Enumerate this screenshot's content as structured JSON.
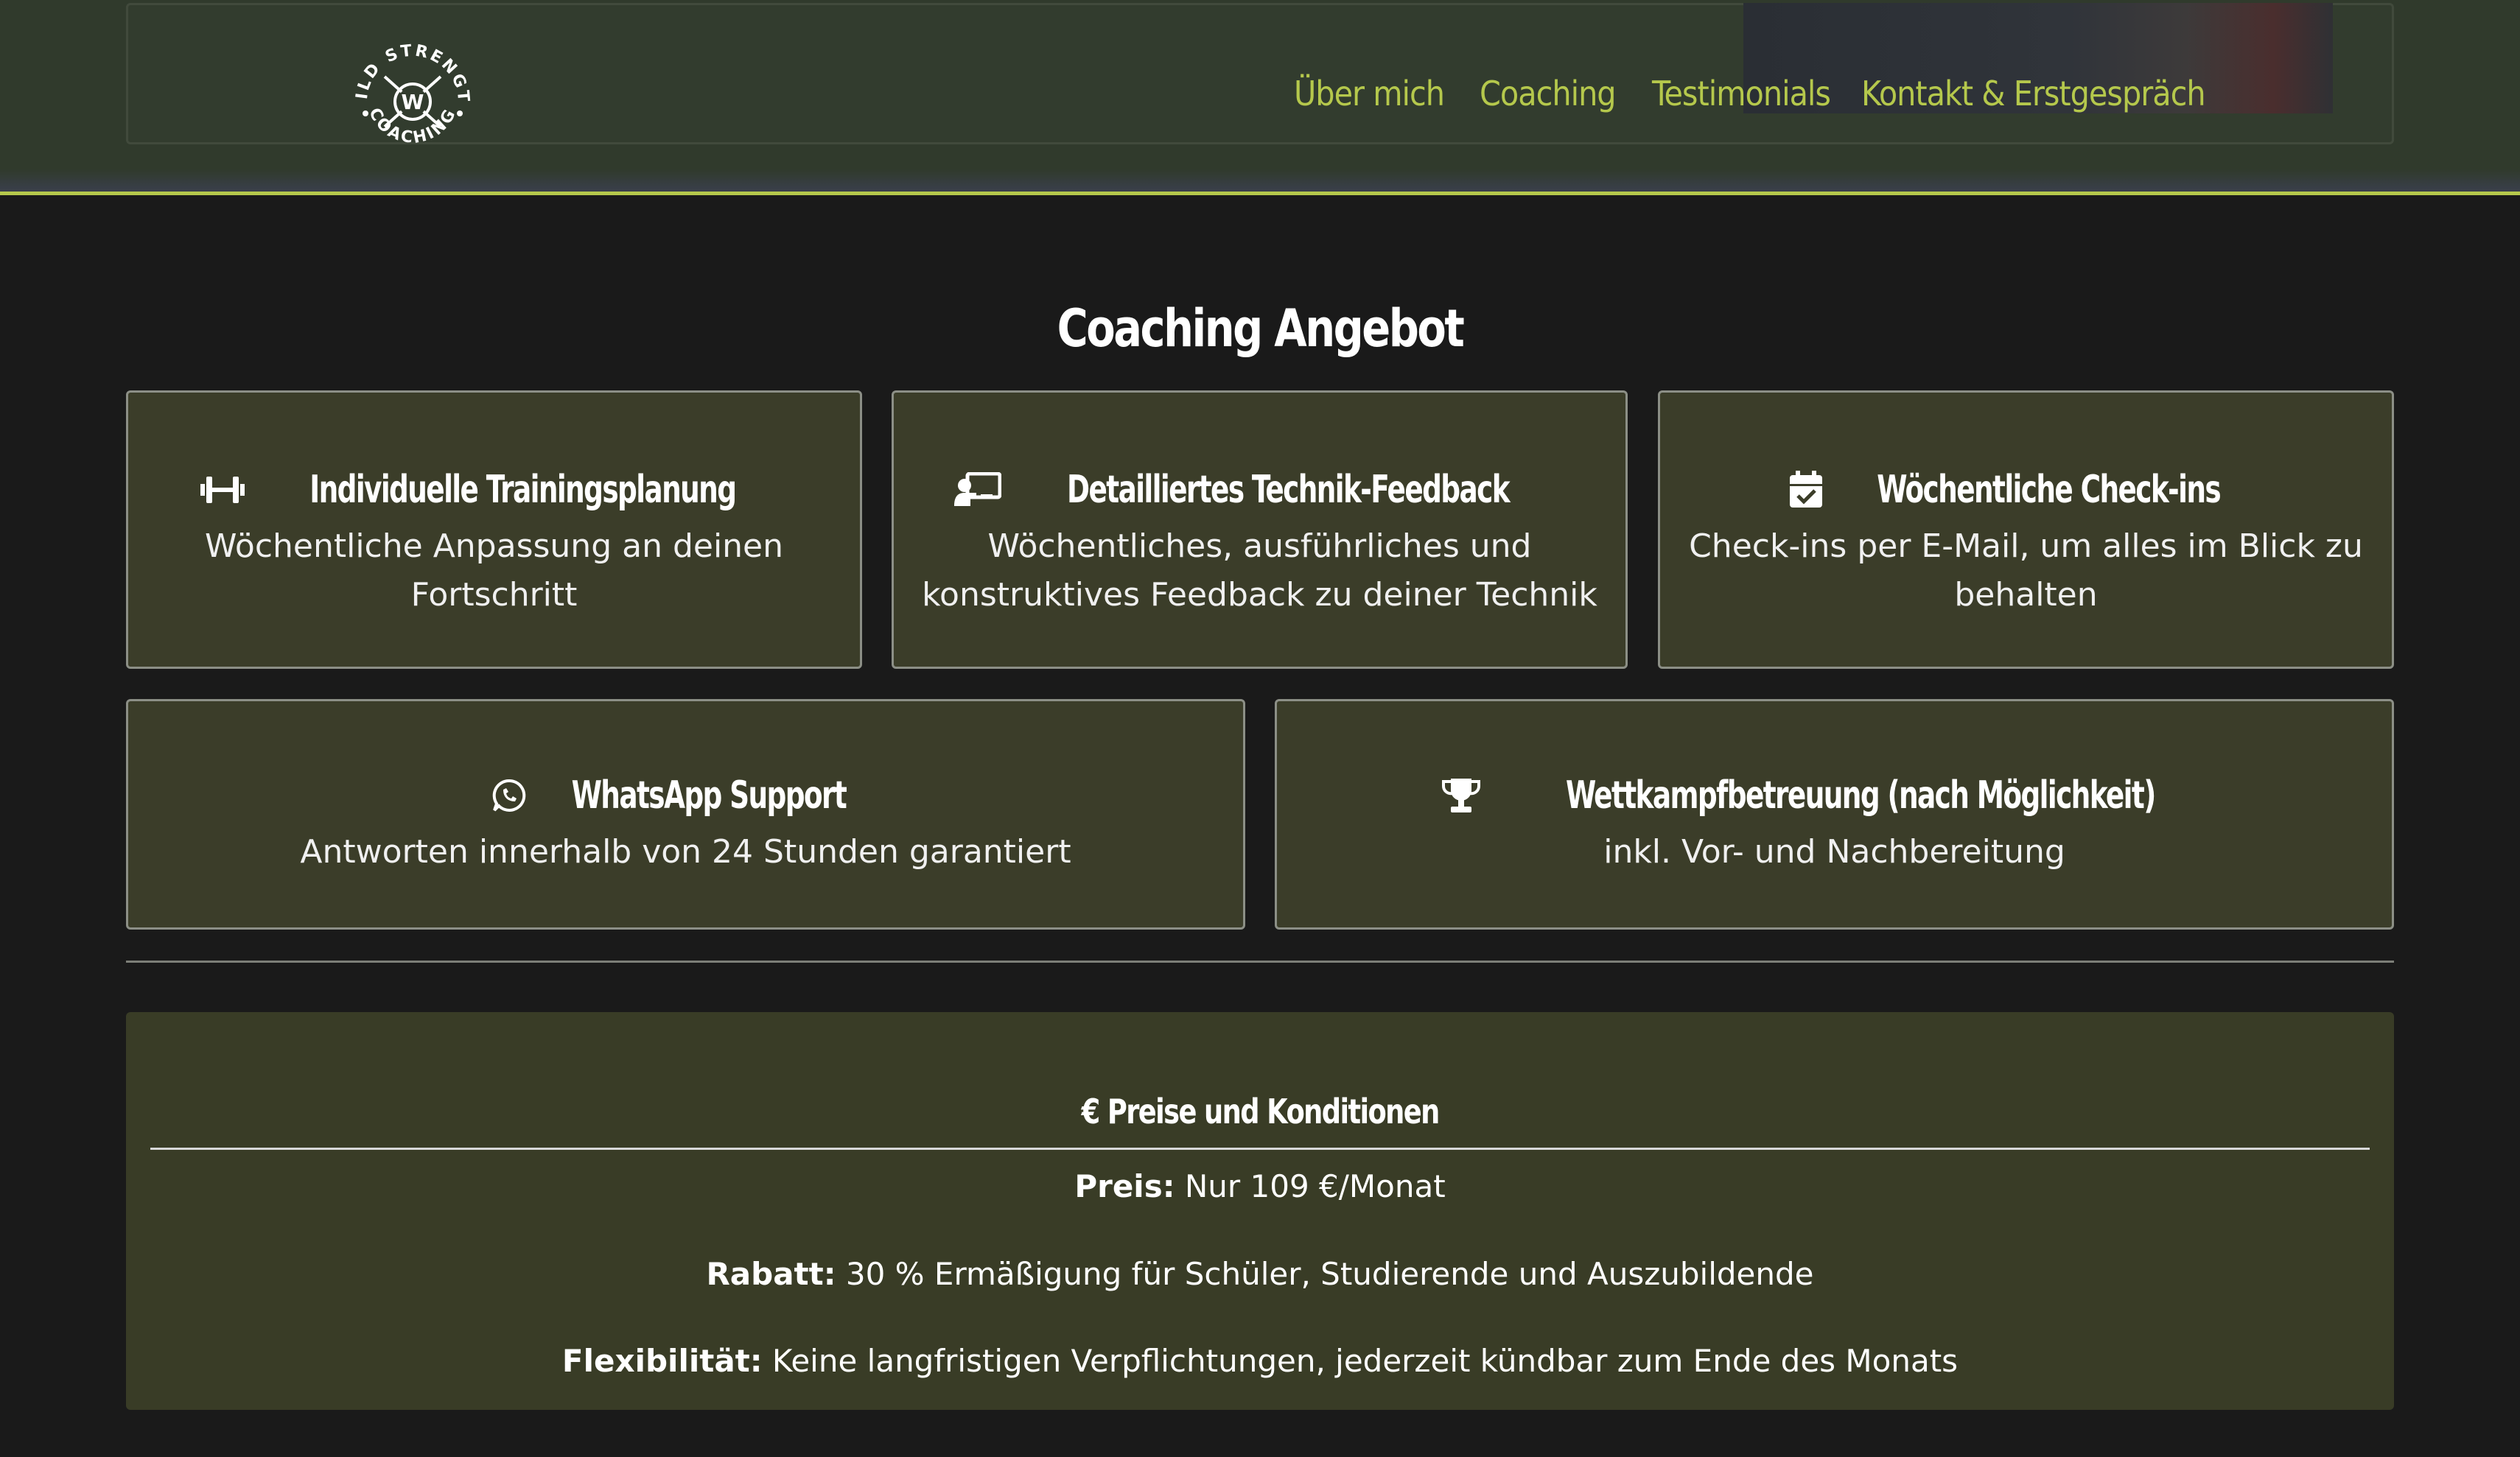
{
  "header": {
    "logo_text_top": "WILD STRENGTH",
    "logo_text_bottom": "COACHING",
    "logo_mark": "W",
    "nav": [
      {
        "label": "Über mich"
      },
      {
        "label": "Coaching"
      },
      {
        "label": "Testimonials"
      },
      {
        "label": "Kontakt & Erstgespräch"
      }
    ]
  },
  "main": {
    "title": "Coaching Angebot",
    "cards": [
      {
        "icon": "dumbbell-icon",
        "title": "Individuelle Trainingsplanung",
        "desc": "Wöchentliche Anpassung an deinen Fortschritt"
      },
      {
        "icon": "chalkboard-teacher-icon",
        "title": "Detailliertes Technik-Feedback",
        "desc": "Wöchentliches, ausführliches und konstruktives Feedback zu deiner Technik"
      },
      {
        "icon": "calendar-check-icon",
        "title": "Wöchentliche Check-ins",
        "desc": "Check-ins per E-Mail, um alles im Blick zu behalten"
      },
      {
        "icon": "whatsapp-icon",
        "title": "WhatsApp Support",
        "desc": "Antworten innerhalb von 24 Stunden garantiert"
      },
      {
        "icon": "trophy-icon",
        "title": "Wettkampfbetreuung (nach Möglichkeit)",
        "desc": "inkl. Vor- und Nachbereitung"
      }
    ]
  },
  "pricing": {
    "title": "€ Preise und Konditionen",
    "lines": [
      {
        "label": "Preis:",
        "value": "Nur 109 €/Monat"
      },
      {
        "label": "Rabatt:",
        "value": "30 % Ermäßigung für Schüler, Studierende und Auszubildende"
      },
      {
        "label": "Flexibilität:",
        "value": "Keine langfristigen Verpflichtungen, jederzeit kündbar zum Ende des Monats"
      }
    ]
  },
  "colors": {
    "accent": "#b5c84c",
    "background": "#1a1a1a",
    "card": "#3b3d29"
  }
}
